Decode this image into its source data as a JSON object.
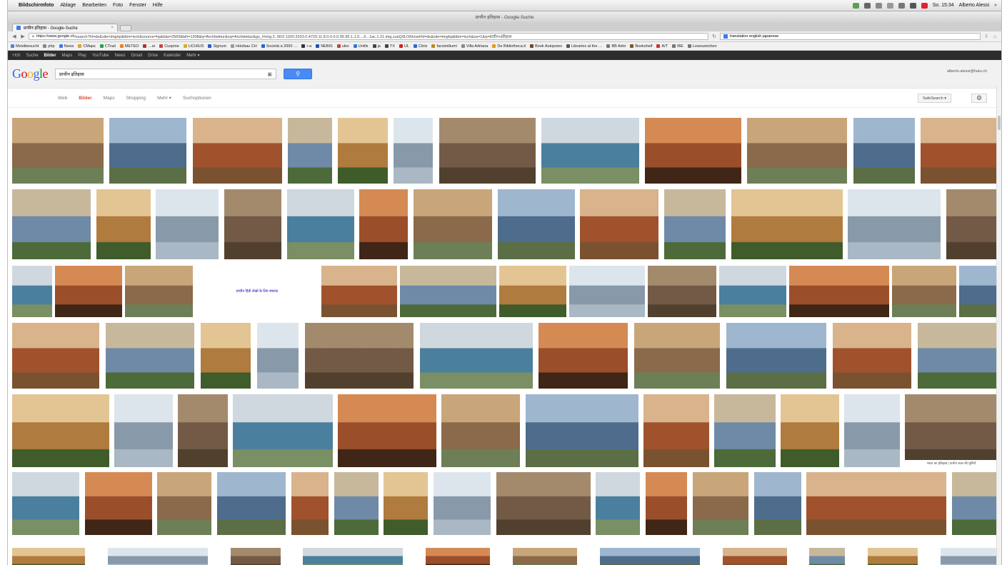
{
  "menubar": {
    "app": "Bildschirmfoto",
    "items": [
      "Ablage",
      "Bearbeiten",
      "Foto",
      "Fenster",
      "Hilfe"
    ],
    "clock": "So. 15:34",
    "user": "Alberto Alessi"
  },
  "window": {
    "title": "प्राचीन इतिहास - Google-Suche"
  },
  "tab": {
    "label": "प्राचीन इतिहास - Google-Suche"
  },
  "address": {
    "url_host": "https://www.google.ch",
    "url_path": "/search?hl=de&site=imghp&tbm=isch&source=hp&biw=2560&bih=1308&q=Architektur&oq=Architektur&gs_l=img.3..0l10.1020.3333.0.4729.11.8.0.0.0.0.95.95.1.1.0....0...1ac.1.21.img.zusQ0LOKknw#hl=de&site=imghp&tbm=isch&sa=1&q=प्राचीन+इतिहास",
    "search_value": "translation english japanese"
  },
  "bookmarks": [
    {
      "label": "Meistbesucht",
      "color": "#5b7fd1"
    },
    {
      "label": "php",
      "color": "#888888"
    },
    {
      "label": "News",
      "color": "#3b7be8"
    },
    {
      "label": "CMaps",
      "color": "#e0a030"
    },
    {
      "label": "CTrad",
      "color": "#2a9d4a"
    },
    {
      "label": "METEO",
      "color": "#f08020"
    },
    {
      "label": "…ei",
      "color": "#a33"
    },
    {
      "label": "Cuopine",
      "color": "#c44"
    },
    {
      "label": "LICHIUS",
      "color": "#d9b01c"
    },
    {
      "label": "Signum",
      "color": "#2b5cc4"
    },
    {
      "label": "Holzbau CH",
      "color": "#999"
    },
    {
      "label": "Società a 2000 …",
      "color": "#1d69c9"
    },
    {
      "label": "r-a",
      "color": "#333"
    },
    {
      "label": "NEBIS",
      "color": "#1f4fa8"
    },
    {
      "label": "ulex",
      "color": "#b44"
    },
    {
      "label": "Unifis",
      "color": "#3477d6"
    },
    {
      "label": "ja",
      "color": "#444"
    },
    {
      "label": "TX",
      "color": "#444"
    },
    {
      "label": "UL",
      "color": "#c22"
    },
    {
      "label": "Citrix",
      "color": "#2d6ad0"
    },
    {
      "label": "facsimiliumi",
      "color": "#c5861b"
    },
    {
      "label": "Villa Adriana",
      "color": "#888"
    },
    {
      "label": "De Bibliotheca.it",
      "color": "#e39a1b"
    },
    {
      "label": "Book Autopsies",
      "color": "#6a4a2a"
    },
    {
      "label": "Libraries at the …",
      "color": "#555"
    },
    {
      "label": "BB Adm",
      "color": "#777"
    },
    {
      "label": "Bookshelf",
      "color": "#7a5a2a"
    },
    {
      "label": "A/T",
      "color": "#c33"
    },
    {
      "label": "IBE",
      "color": "#777"
    },
    {
      "label": "Leseszeichen",
      "color": "#777"
    }
  ],
  "google_bar": [
    "+Ich",
    "Suche",
    "Bilder",
    "Maps",
    "Play",
    "YouTube",
    "News",
    "Gmail",
    "Drive",
    "Kalender",
    "Mehr"
  ],
  "google_bar_active": "Bilder",
  "query": "प्राचीन इतिहास",
  "account": "alberto.alessi@hatu.ch",
  "subnav": [
    "Web",
    "Bilder",
    "Maps",
    "Shopping",
    "Mehr",
    "Suchoptionen"
  ],
  "subnav_active": "Bilder",
  "safesearch": "SafeSearch",
  "image_caption": "प्राचीन हिंदी लेखों के लिए स्मारक",
  "image_caption_2": "भारत का इतिहास | प्राचीन काल की मूर्तियाँ"
}
